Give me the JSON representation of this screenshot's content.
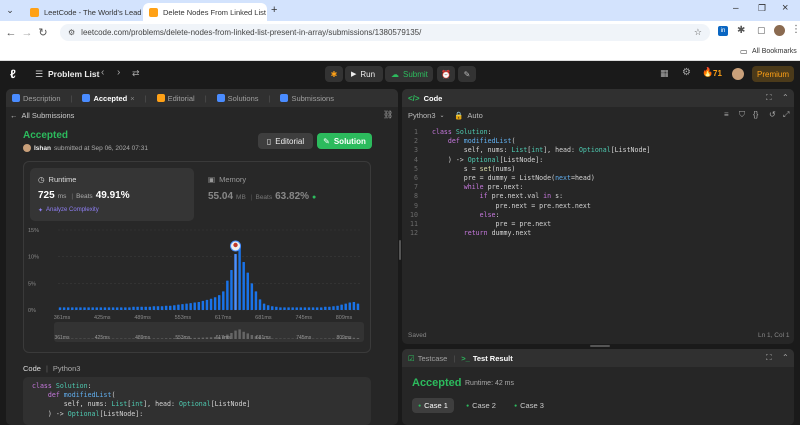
{
  "browser": {
    "tabs": [
      {
        "title": "LeetCode - The World's Leading",
        "active": false
      },
      {
        "title": "Delete Nodes From Linked List",
        "active": true
      }
    ],
    "url": "leetcode.com/problems/delete-nodes-from-linked-list-present-in-array/submissions/1380579135/",
    "bookmarks_label": "All Bookmarks"
  },
  "header": {
    "problem_list": "Problem List",
    "run": "Run",
    "submit": "Submit",
    "streak": "71",
    "premium": "Premium"
  },
  "left": {
    "tabs": [
      {
        "label": "Description"
      },
      {
        "label": "Accepted"
      },
      {
        "label": "Editorial"
      },
      {
        "label": "Solutions"
      },
      {
        "label": "Submissions"
      }
    ],
    "all_submissions": "All Submissions",
    "status": "Accepted",
    "user": "Ishan",
    "submitted": "submitted at Sep 06, 2024 07:31",
    "editorial_btn": "Editorial",
    "solution_btn": "Solution",
    "runtime": {
      "label": "Runtime",
      "value": "725",
      "unit": "ms",
      "beats_label": "Beats",
      "beats": "49.91%",
      "analyze": "Analyze Complexity"
    },
    "memory": {
      "label": "Memory",
      "value": "55.04",
      "unit": "MB",
      "beats_label": "Beats",
      "beats": "63.82%"
    },
    "code_label": "Code",
    "code_lang": "Python3",
    "code_preview": [
      "class Solution:",
      "    def modifiedList(",
      "        self, nums: List[int], head: Optional[ListNode]",
      "    ) -> Optional[ListNode]:"
    ]
  },
  "chart_data": {
    "type": "bar",
    "ylim": [
      0,
      15
    ],
    "y_ticks": [
      "15%",
      "10%",
      "5%",
      "0%"
    ],
    "x_ticks": [
      "361ms",
      "425ms",
      "489ms",
      "553ms",
      "617ms",
      "681ms",
      "745ms",
      "809ms"
    ],
    "mini_ticks": [
      "361ms",
      "425ms",
      "489ms",
      "553ms",
      "617ms",
      "681ms",
      "745ms",
      "809ms"
    ],
    "values": [
      0.5,
      0.5,
      0.5,
      0.5,
      0.5,
      0.5,
      0.5,
      0.5,
      0.5,
      0.5,
      0.5,
      0.5,
      0.5,
      0.5,
      0.5,
      0.5,
      0.5,
      0.5,
      0.6,
      0.6,
      0.6,
      0.6,
      0.6,
      0.7,
      0.7,
      0.7,
      0.8,
      0.8,
      0.9,
      1.0,
      1.1,
      1.2,
      1.3,
      1.4,
      1.5,
      1.7,
      1.9,
      2.1,
      2.4,
      2.8,
      3.5,
      5.5,
      7.5,
      10.5,
      12.0,
      9.0,
      7.0,
      5.0,
      3.5,
      2.0,
      1.2,
      0.9,
      0.7,
      0.6,
      0.5,
      0.5,
      0.5,
      0.5,
      0.5,
      0.5,
      0.5,
      0.5,
      0.5,
      0.5,
      0.5,
      0.6,
      0.6,
      0.7,
      0.8,
      1.0,
      1.2,
      1.4,
      1.5,
      1.2
    ],
    "highlight_index": 43
  },
  "right": {
    "code_title": "Code",
    "lang": "Python3",
    "auto": "Auto",
    "saved": "Saved",
    "cursor": "Ln 1, Col 1",
    "lines": [
      "class Solution:",
      "    def modifiedList(",
      "        self, nums: List[int], head: Optional[ListNode]",
      "    ) -> Optional[ListNode]:",
      "        s = set(nums)",
      "        pre = dummy = ListNode(next=head)",
      "        while pre.next:",
      "            if pre.next.val in s:",
      "                pre.next = pre.next.next",
      "            else:",
      "                pre = pre.next",
      "        return dummy.next"
    ],
    "testcase_tab": "Testcase",
    "result_tab": "Test Result",
    "result_status": "Accepted",
    "result_runtime": "Runtime: 42 ms",
    "cases": [
      "Case 1",
      "Case 2",
      "Case 3"
    ]
  },
  "colors": {
    "accent": "#ffa116",
    "success": "#2cbb5d",
    "bar": "#1a73e8",
    "link": "#7aa7ff"
  }
}
